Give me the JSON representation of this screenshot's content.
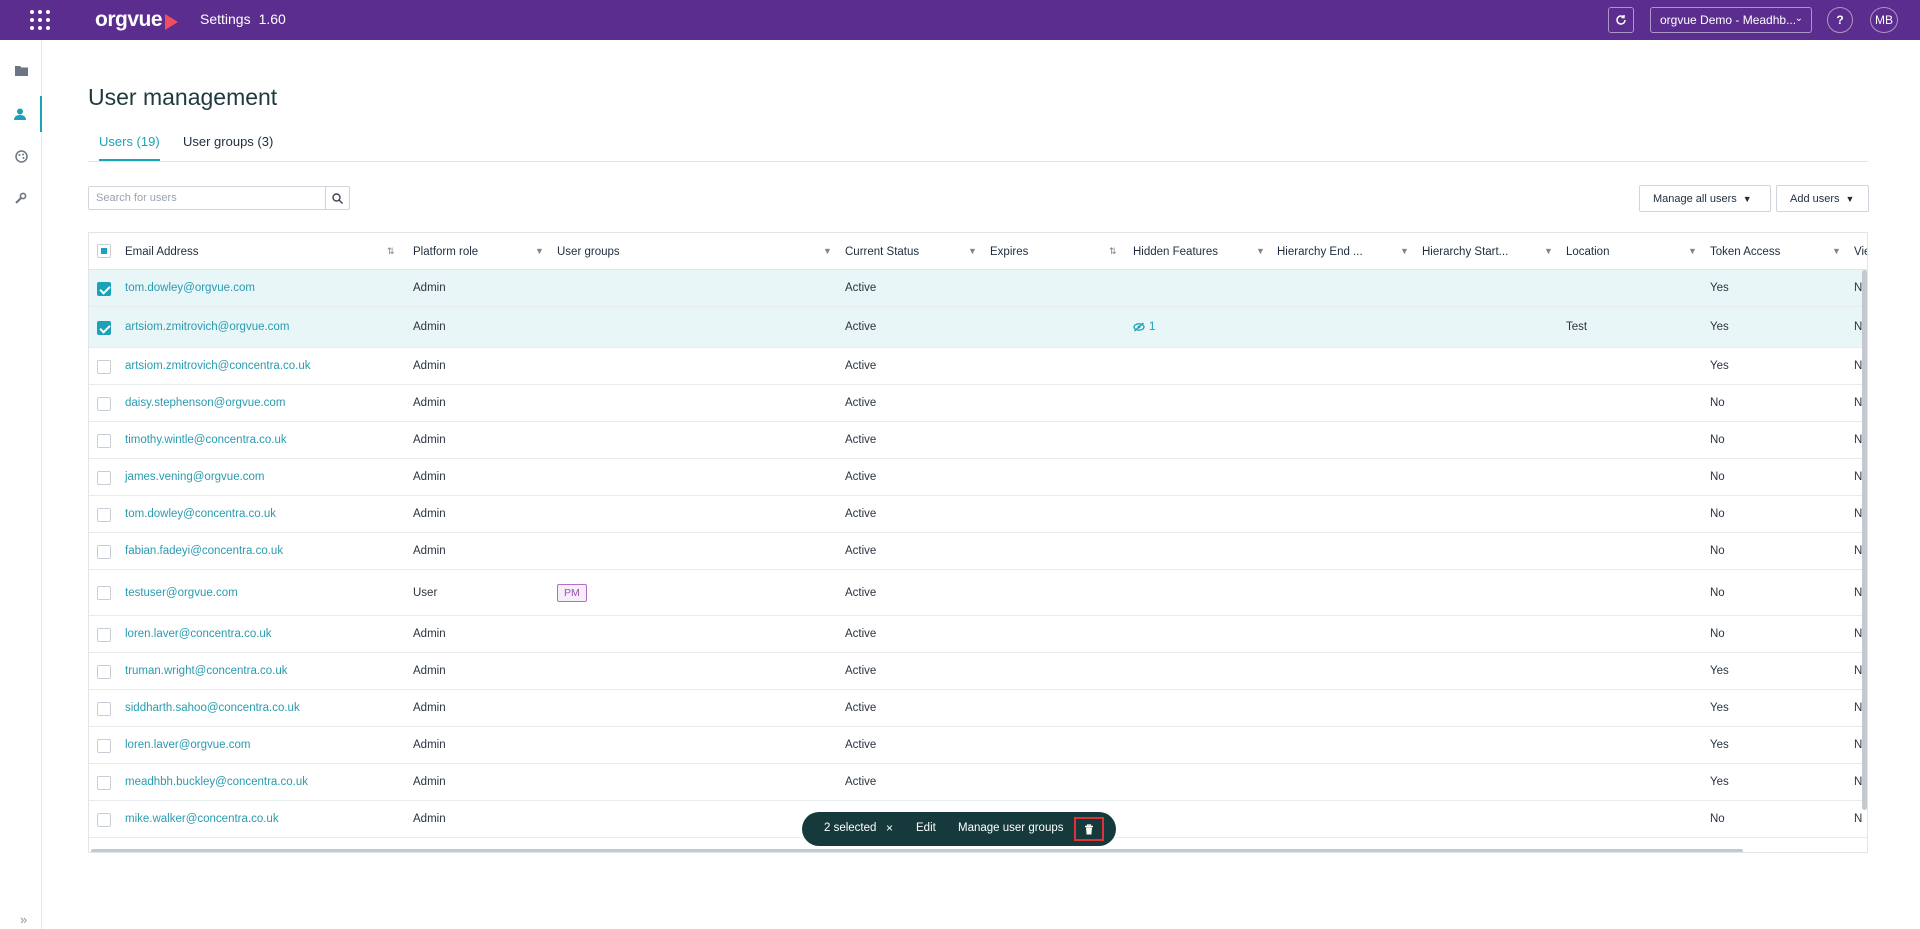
{
  "topbar": {
    "logo_text": "orgvue",
    "app_name": "Settings",
    "version": "1.60",
    "org_selector": "orgvue Demo - Meadhb...",
    "help_label": "?",
    "avatar_initials": "MB"
  },
  "page": {
    "title": "User management",
    "tabs": [
      {
        "label": "Users (19)",
        "active": true
      },
      {
        "label": "User groups (3)",
        "active": false
      }
    ],
    "search_placeholder": "Search for users",
    "manage_all_users": "Manage all users",
    "add_users": "Add users"
  },
  "table": {
    "columns": [
      "Email Address",
      "Platform role",
      "User groups",
      "Current Status",
      "Expires",
      "Hidden Features",
      "Hierarchy End ...",
      "Hierarchy Start...",
      "Location",
      "Token Access",
      "Vie"
    ],
    "rows": [
      {
        "checked": true,
        "email": "tom.dowley@orgvue.com",
        "role": "Admin",
        "groups": "",
        "status": "Active",
        "hidden": "",
        "location": "",
        "token": "Yes",
        "view": "N"
      },
      {
        "checked": true,
        "email": "artsiom.zmitrovich@orgvue.com",
        "role": "Admin",
        "groups": "",
        "status": "Active",
        "hidden": "1",
        "location": "Test",
        "token": "Yes",
        "view": "N"
      },
      {
        "checked": false,
        "email": "artsiom.zmitrovich@concentra.co.uk",
        "role": "Admin",
        "groups": "",
        "status": "Active",
        "hidden": "",
        "location": "",
        "token": "Yes",
        "view": "N"
      },
      {
        "checked": false,
        "email": "daisy.stephenson@orgvue.com",
        "role": "Admin",
        "groups": "",
        "status": "Active",
        "hidden": "",
        "location": "",
        "token": "No",
        "view": "N"
      },
      {
        "checked": false,
        "email": "timothy.wintle@concentra.co.uk",
        "role": "Admin",
        "groups": "",
        "status": "Active",
        "hidden": "",
        "location": "",
        "token": "No",
        "view": "N"
      },
      {
        "checked": false,
        "email": "james.vening@orgvue.com",
        "role": "Admin",
        "groups": "",
        "status": "Active",
        "hidden": "",
        "location": "",
        "token": "No",
        "view": "N"
      },
      {
        "checked": false,
        "email": "tom.dowley@concentra.co.uk",
        "role": "Admin",
        "groups": "",
        "status": "Active",
        "hidden": "",
        "location": "",
        "token": "No",
        "view": "N"
      },
      {
        "checked": false,
        "email": "fabian.fadeyi@concentra.co.uk",
        "role": "Admin",
        "groups": "",
        "status": "Active",
        "hidden": "",
        "location": "",
        "token": "No",
        "view": "N"
      },
      {
        "checked": false,
        "email": "testuser@orgvue.com",
        "role": "User",
        "groups": "PM",
        "status": "Active",
        "hidden": "",
        "location": "",
        "token": "No",
        "view": "N"
      },
      {
        "checked": false,
        "email": "loren.laver@concentra.co.uk",
        "role": "Admin",
        "groups": "",
        "status": "Active",
        "hidden": "",
        "location": "",
        "token": "No",
        "view": "N"
      },
      {
        "checked": false,
        "email": "truman.wright@concentra.co.uk",
        "role": "Admin",
        "groups": "",
        "status": "Active",
        "hidden": "",
        "location": "",
        "token": "Yes",
        "view": "N"
      },
      {
        "checked": false,
        "email": "siddharth.sahoo@concentra.co.uk",
        "role": "Admin",
        "groups": "",
        "status": "Active",
        "hidden": "",
        "location": "",
        "token": "Yes",
        "view": "N"
      },
      {
        "checked": false,
        "email": "loren.laver@orgvue.com",
        "role": "Admin",
        "groups": "",
        "status": "Active",
        "hidden": "",
        "location": "",
        "token": "Yes",
        "view": "N"
      },
      {
        "checked": false,
        "email": "meadhbh.buckley@concentra.co.uk",
        "role": "Admin",
        "groups": "",
        "status": "Active",
        "hidden": "",
        "location": "",
        "token": "Yes",
        "view": "N"
      },
      {
        "checked": false,
        "email": "mike.walker@concentra.co.uk",
        "role": "Admin",
        "groups": "",
        "status": "",
        "hidden": "",
        "location": "",
        "token": "No",
        "view": "N"
      }
    ]
  },
  "action_bar": {
    "selected_text": "2 selected",
    "clear_label": "×",
    "edit_label": "Edit",
    "manage_groups_label": "Manage user groups"
  },
  "icons": {
    "apps": "apps-grid-icon",
    "refresh": "refresh-icon",
    "folder": "folder-icon",
    "user": "user-icon",
    "palette": "palette-icon",
    "wrench": "wrench-icon",
    "search": "search-icon",
    "filter": "filter-icon",
    "sort": "sort-icon",
    "trash": "trash-icon",
    "hidden": "eye-slash-icon",
    "expand": "expand-chevron-icon"
  },
  "colors": {
    "topbar": "#5b2d8e",
    "accent": "#1aa3b8",
    "action_bar": "#163a3c",
    "delete_highlight": "#e0303a",
    "badge": "#9a4fb8"
  }
}
